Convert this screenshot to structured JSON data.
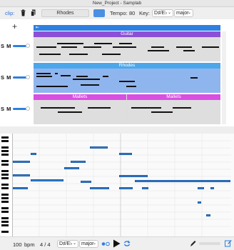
{
  "window": {
    "title": "New_Project - Samplab"
  },
  "toolbar": {
    "clip_label": "clip:",
    "trash_icon": "trash-icon",
    "copy_icon": "copy-icon",
    "instrument_name": "Rhodes",
    "clip_color": "#4a90e2",
    "tempo_label": "Tempo:",
    "tempo_value": "80",
    "key_label": "Key:",
    "key_value": "D♯/E♭",
    "scale_value": "major"
  },
  "tracks": {
    "add_button": "+",
    "items": [
      {
        "sm": "S M",
        "clips": [
          {
            "name": "Guitar",
            "color": "#8d4fd6"
          }
        ]
      },
      {
        "sm": "S M",
        "clips": [
          {
            "name": "Rhodes",
            "color": "#4ca7ea"
          }
        ]
      },
      {
        "sm": "S M",
        "clips": [
          {
            "name": "Mallets",
            "color": "#d94fe2"
          },
          {
            "name": "Mallets",
            "color": "#d94fe2"
          }
        ]
      }
    ]
  },
  "bottom": {
    "bpm_value": "100",
    "bpm_label": "bpm",
    "time_signature": "4 / 4",
    "key_value": "D♯/E♭",
    "scale_value": "major",
    "metronome_icon": "metronome-icon",
    "play_icon": "play-icon",
    "loop_icon": "loop-icon",
    "pencil_icon": "pencil-icon",
    "edit_icon": "edit-icon"
  }
}
